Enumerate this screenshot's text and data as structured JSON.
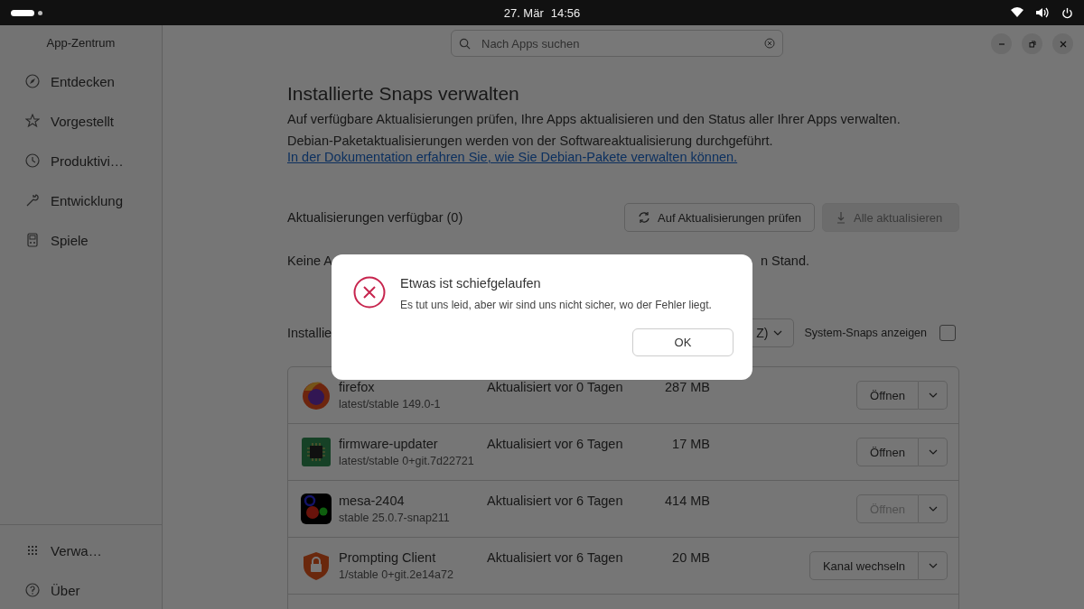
{
  "top_bar": {
    "date": "27. Mär",
    "time": "14:56"
  },
  "window": {
    "title": "App-Zentrum",
    "search": {
      "placeholder": "Nach Apps suchen"
    }
  },
  "sidebar": {
    "items": [
      {
        "label": "Entdecken",
        "kind": "compass"
      },
      {
        "label": "Vorgestellt",
        "kind": "star"
      },
      {
        "label": "Produktivi…",
        "kind": "clock"
      },
      {
        "label": "Entwicklung",
        "kind": "wrench"
      },
      {
        "label": "Spiele",
        "kind": "gamepad"
      }
    ],
    "footer_items": [
      {
        "label": "Verwa…",
        "kind": "grid"
      },
      {
        "label": "Über",
        "kind": "help"
      }
    ]
  },
  "page": {
    "title": "Installierte Snaps verwalten",
    "description": "Auf verfügbare Aktualisierungen prüfen, Ihre Apps aktualisieren und den Status aller Ihrer Apps verwalten.",
    "note": "Debian-Paketaktualisierungen werden von der Softwareaktualisierung durchgeführt.",
    "link": "In der Dokumentation erfahren Sie, wie Sie Debian-Pakete verwalten können."
  },
  "updates": {
    "heading": "Aktualisierungen verfügbar (0)",
    "check_button": "Auf Aktualisierungen prüfen",
    "update_all_button": {
      "label": "Alle aktualisieren",
      "disabled": true
    },
    "status_start": "Keine A",
    "status_end": "n Stand."
  },
  "installed": {
    "heading": "Installie",
    "sort_end": "Z)",
    "system_snaps": {
      "label": "System-Snaps anzeigen",
      "checked": false
    }
  },
  "apps": [
    {
      "name": "firefox",
      "channel": "latest/stable 149.0-1",
      "updated": "Aktualisiert vor 0 Tagen",
      "size": "287 MB",
      "kind": "firefox",
      "action": {
        "label": "Öffnen",
        "disabled": false
      }
    },
    {
      "name": "firmware-updater",
      "channel": "latest/stable 0+git.7d22721",
      "updated": "Aktualisiert vor 6 Tagen",
      "size": "17 MB",
      "kind": "chip",
      "action": {
        "label": "Öffnen",
        "disabled": false
      }
    },
    {
      "name": "mesa-2404",
      "channel": "stable 25.0.7-snap211",
      "updated": "Aktualisiert vor 6 Tagen",
      "size": "414 MB",
      "kind": "gears",
      "action": {
        "label": "Öffnen",
        "disabled": true
      }
    },
    {
      "name": "Prompting Client",
      "channel": "1/stable 0+git.2e14a72",
      "updated": "Aktualisiert vor 6 Tagen",
      "size": "20 MB",
      "kind": "shield",
      "action": {
        "label": "Kanal wechseln",
        "disabled": false
      }
    }
  ],
  "dialog": {
    "title": "Etwas ist schiefgelaufen",
    "message": "Es tut uns leid, aber wir sind uns nicht sicher, wo der Fehler liegt.",
    "button": "OK"
  }
}
